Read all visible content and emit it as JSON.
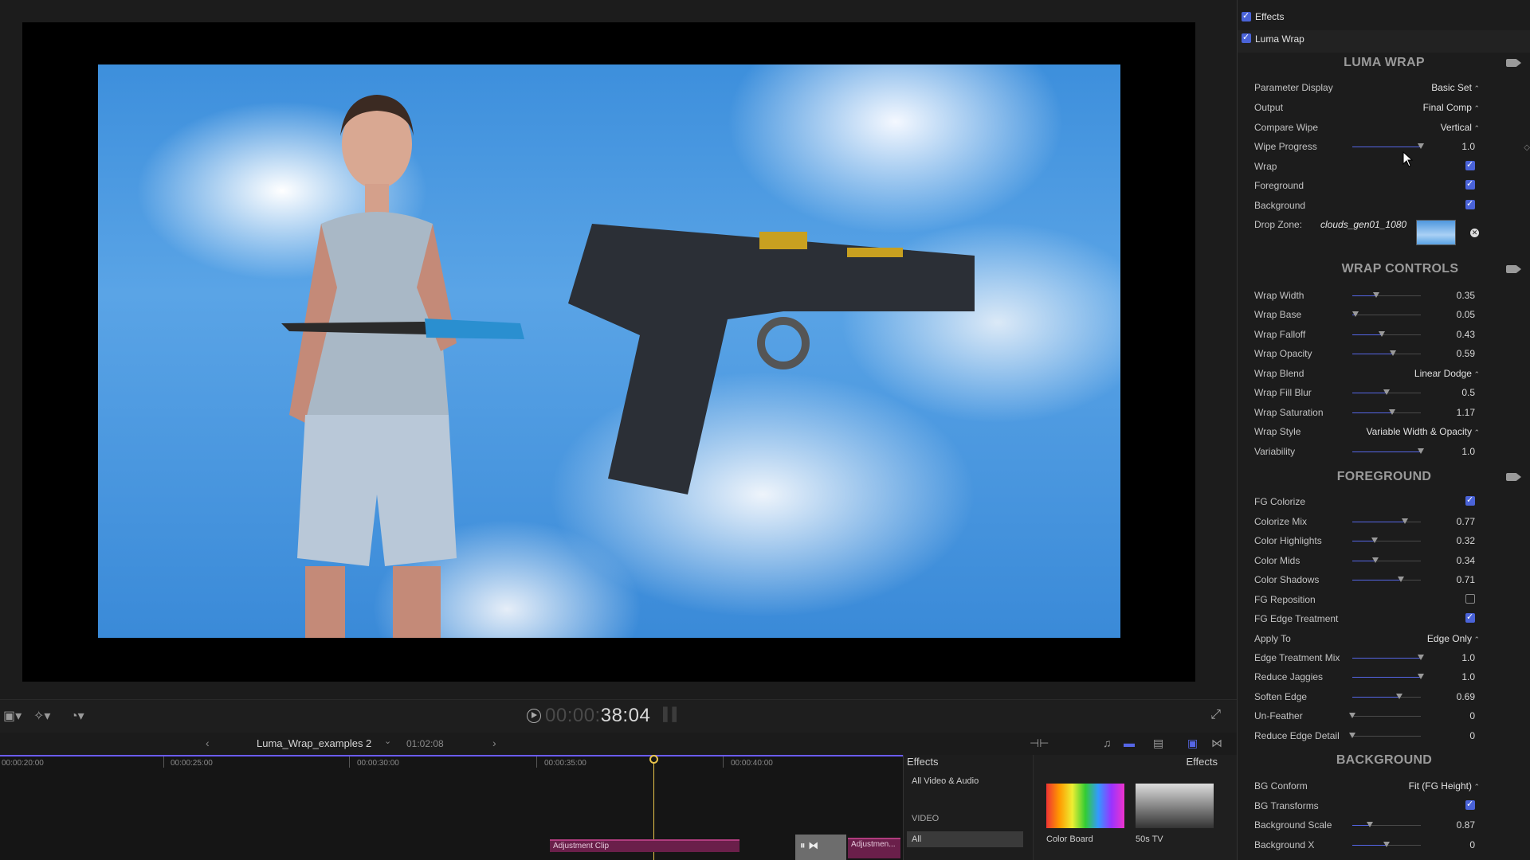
{
  "viewer": {
    "timecode_dim": "00:00:",
    "timecode": "38:04"
  },
  "timeline": {
    "project_name": "Luma_Wrap_examples 2",
    "duration": "01:02:08",
    "ruler_ticks": [
      "00:00:20:00",
      "00:00:25:00",
      "00:00:30:00",
      "00:00:35:00",
      "00:00:40:00"
    ],
    "clips": [
      "Adjustment Clip",
      "Adjustmen..."
    ]
  },
  "effects_browser": {
    "title": "Effects",
    "grid_title": "Effects",
    "categories": [
      "All Video & Audio",
      "VIDEO",
      "All"
    ],
    "thumbs": [
      "Color Board",
      "50s TV"
    ]
  },
  "inspector": {
    "effects_label": "Effects",
    "effect_name": "Luma Wrap",
    "sections": {
      "luma_wrap": "LUMA WRAP",
      "wrap_controls": "WRAP CONTROLS",
      "foreground": "FOREGROUND",
      "background": "BACKGROUND"
    },
    "params": [
      {
        "label": "Parameter Display",
        "kind": "popup",
        "value": "Basic Set"
      },
      {
        "label": "Output",
        "kind": "popup",
        "value": "Final Comp"
      },
      {
        "label": "Compare Wipe",
        "kind": "popup",
        "value": "Vertical"
      },
      {
        "label": "Wipe Progress",
        "kind": "slider",
        "value": "1.0",
        "level": 1.0
      },
      {
        "label": "Wrap",
        "kind": "check",
        "checked": true
      },
      {
        "label": "Foreground",
        "kind": "check",
        "checked": true
      },
      {
        "label": "Background",
        "kind": "check",
        "checked": true
      },
      {
        "label": "Drop Zone:",
        "kind": "dropzone",
        "value": "clouds_gen01_1080"
      },
      {
        "label": "Wrap Width",
        "kind": "slider",
        "value": "0.35",
        "level": 0.35
      },
      {
        "label": "Wrap Base",
        "kind": "slider",
        "value": "0.05",
        "level": 0.05
      },
      {
        "label": "Wrap Falloff",
        "kind": "slider",
        "value": "0.43",
        "level": 0.43
      },
      {
        "label": "Wrap Opacity",
        "kind": "slider",
        "value": "0.59",
        "level": 0.59
      },
      {
        "label": "Wrap Blend",
        "kind": "popup",
        "value": "Linear Dodge"
      },
      {
        "label": "Wrap Fill Blur",
        "kind": "slider",
        "value": "0.5",
        "level": 0.5
      },
      {
        "label": "Wrap Saturation",
        "kind": "slider",
        "value": "1.17",
        "level": 0.58
      },
      {
        "label": "Wrap Style",
        "kind": "popup",
        "value": "Variable Width & Opacity"
      },
      {
        "label": "Variability",
        "kind": "slider",
        "value": "1.0",
        "level": 1.0
      },
      {
        "label": "FG Colorize",
        "kind": "check",
        "checked": true
      },
      {
        "label": "Colorize Mix",
        "kind": "slider",
        "value": "0.77",
        "level": 0.77
      },
      {
        "label": "Color Highlights",
        "kind": "slider",
        "value": "0.32",
        "level": 0.32
      },
      {
        "label": "Color Mids",
        "kind": "slider",
        "value": "0.34",
        "level": 0.34
      },
      {
        "label": "Color Shadows",
        "kind": "slider",
        "value": "0.71",
        "level": 0.71
      },
      {
        "label": "FG Reposition",
        "kind": "check",
        "checked": false
      },
      {
        "label": "FG Edge Treatment",
        "kind": "check",
        "checked": true
      },
      {
        "label": "Apply To",
        "kind": "popup",
        "value": "Edge Only"
      },
      {
        "label": "Edge Treatment Mix",
        "kind": "slider",
        "value": "1.0",
        "level": 1.0
      },
      {
        "label": "Reduce Jaggies",
        "kind": "slider",
        "value": "1.0",
        "level": 1.0
      },
      {
        "label": "Soften Edge",
        "kind": "slider",
        "value": "0.69",
        "level": 0.69
      },
      {
        "label": "Un-Feather",
        "kind": "slider",
        "value": "0",
        "level": 0
      },
      {
        "label": "Reduce Edge Detail",
        "kind": "slider",
        "value": "0",
        "level": 0
      },
      {
        "label": "BG Conform",
        "kind": "popup",
        "value": "Fit (FG Height)"
      },
      {
        "label": "BG Transforms",
        "kind": "check",
        "checked": true
      },
      {
        "label": "Background Scale",
        "kind": "slider",
        "value": "0.87",
        "level": 0.25
      },
      {
        "label": "Background X",
        "kind": "slider",
        "value": "0",
        "level": 0.5
      }
    ]
  },
  "colors": {
    "accent": "#4a63d8",
    "clip": "#6a1f4a",
    "playhead": "#e8c44a"
  }
}
